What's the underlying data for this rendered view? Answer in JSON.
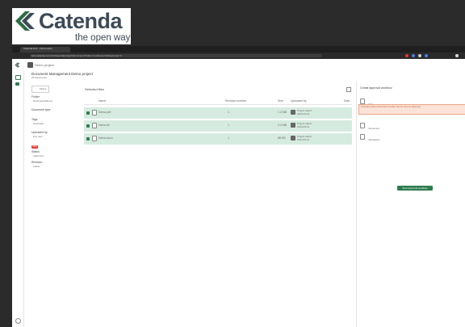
{
  "logo": {
    "word": "Catenda",
    "tagline": "the open way"
  },
  "browser": {
    "tab_title": "Catenda Hub - Documents",
    "url": "hub.catenda.com/v2/t/catenda/project/documents?folder=root&view=list&selected=3",
    "colors": {
      "accent": "#2e7d4f",
      "selection": "#d6ebe0",
      "warning": "#f0a483"
    }
  },
  "appbar": {
    "project": "Demo project",
    "breadcrumb": "Documents"
  },
  "page": {
    "title": "Document Management Demo project",
    "subtitle": "All documents"
  },
  "filters": {
    "search_placeholder": "Filters",
    "groups": [
      {
        "label": "Folder",
        "value": "Documents/Demo"
      },
      {
        "label": "Document type",
        "value": ""
      },
      {
        "label": "Tags",
        "value": "Structural"
      },
      {
        "label": "Uploaded by",
        "value": "Any user"
      },
      {
        "label": "Status",
        "value": "Approved"
      },
      {
        "label": "Revision",
        "value": "Latest"
      }
    ],
    "badge": "NEW"
  },
  "table": {
    "heading": "Selected files",
    "columns": [
      "Name",
      "Revision number",
      "Size",
      "Uploaded by",
      "Date"
    ],
    "rows": [
      {
        "name": "Demo.pdf",
        "revision": "1",
        "size": "1.2 MB",
        "user": "Project admin",
        "date": "2024-03-12"
      },
      {
        "name": "Demo.ifc",
        "revision": "1",
        "size": "3.4 MB",
        "user": "Project admin",
        "date": "2024-03-12"
      },
      {
        "name": "Demo.docx",
        "revision": "1",
        "size": "88 KB",
        "user": "Project admin",
        "date": "2024-03-12"
      }
    ]
  },
  "panel": {
    "title": "Create approval workflow",
    "file_label": "Files",
    "warning": "Only files with a document number can be sent for approval",
    "items": [
      "Document",
      "Reviewers"
    ],
    "button": "Start approval workflow"
  }
}
